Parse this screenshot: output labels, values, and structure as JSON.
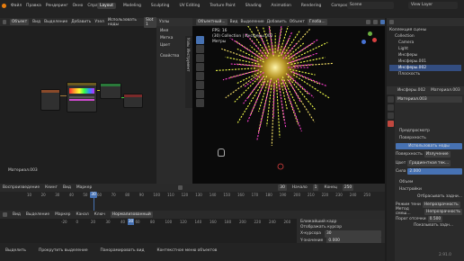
{
  "top": {
    "menus": [
      "Файл",
      "Правка",
      "Рендеринг",
      "Окно",
      "Справка"
    ],
    "workspaces": [
      "Layout",
      "Modeling",
      "Sculpting",
      "UV Editing",
      "Texture Paint",
      "Shading",
      "Animation",
      "Rendering",
      "Compositing",
      "Scripting"
    ],
    "active_workspace": "Layout",
    "scene": "Scene",
    "view_layer": "View Layer"
  },
  "node_editor": {
    "header": [
      "Объект",
      "Вид",
      "Выделение",
      "Добавить",
      "Узел",
      "Использовать ноды"
    ],
    "slot": "Slot 1",
    "material_label": "Материал.003",
    "sidebar_tabs": [
      "Узлы",
      "Инструмент",
      "Вид"
    ],
    "sidebar_title": "Узлы",
    "sidebar_items": [
      "Имя",
      "Метка",
      "Цвет",
      "Свойства"
    ]
  },
  "viewport": {
    "header": [
      "Объектный...",
      "Вид",
      "Выделение",
      "Добавить",
      "Объект"
    ],
    "global": "Глоба...",
    "overlay": {
      "fps": "FPS: 16",
      "collection": "(30) Collection | Инсферы.002",
      "meters": "Метры"
    },
    "side_tabs": [
      "Элемент",
      "Инструмент",
      "Вид"
    ]
  },
  "outliner": {
    "title": "Коллекция сцены",
    "items": [
      "Collection",
      "Camera",
      "Light",
      "Инсферы",
      "Инсферы.001",
      "Инсферы.002",
      "Плоскость"
    ]
  },
  "properties": {
    "object": "Инсферы.002",
    "material_header": "Материал.003",
    "material_slot": "Материал.003",
    "panels": [
      "Предпросмотр",
      "Поверхность"
    ],
    "use_nodes": "Использовать ноды",
    "surface_label": "Поверхность",
    "surface_value": "Излучение",
    "color_label": "Цвет",
    "color_value": "Градиентная тек...",
    "strength_label": "Сила",
    "strength_value": "2.000",
    "volume": "Объем",
    "settings": "Настройки",
    "backface": "Отбрасывать задни...",
    "shadow_label": "Режим тени",
    "shadow_value": "Непрозрачность",
    "blend_label": "Метод смеш...",
    "blend_value": "Непрозрачность",
    "clip": "Порог отсечки",
    "clip_value": "0.500",
    "show_backface": "Показывать задн..."
  },
  "timeline": {
    "menus": [
      "Воспроизведение",
      "Кеинг",
      "Вид",
      "Маркер"
    ],
    "frame": "30",
    "start_label": "Начало",
    "start": "1",
    "end_label": "Конец",
    "end": "250",
    "ticks": [
      "10",
      "20",
      "30",
      "40",
      "50",
      "60",
      "70",
      "80",
      "90",
      "100",
      "110",
      "120",
      "130",
      "140",
      "150",
      "160",
      "170",
      "180",
      "190",
      "200",
      "210",
      "220",
      "230",
      "240",
      "250"
    ]
  },
  "graph_editor": {
    "menus": [
      "Вид",
      "Выделение",
      "Маркер",
      "Канал",
      "Ключ"
    ],
    "mode": "Нормализованный",
    "panel": [
      "Ближайший кадр",
      "Отображать курсор",
      "X-курсора",
      "Y-значение"
    ],
    "x_value": "30",
    "y_value": "0.000",
    "ticks": [
      "-20",
      "0",
      "20",
      "30",
      "40",
      "60",
      "80",
      "100",
      "120",
      "140",
      "160",
      "180",
      "200",
      "220",
      "240",
      "260"
    ]
  },
  "status": {
    "left": "Выделить",
    "middle": "Прокрутить выделение",
    "right": "Панорамировать вид",
    "context": "Контекстное меню объектов",
    "version": "2.91.0"
  },
  "colors": {
    "accent": "#4772b3",
    "active_tab": "#3d3d3d",
    "firework_core": "#ffe96b",
    "firework_pink": "#ff3fd0",
    "firework_yellow": "#f3ff4a"
  }
}
